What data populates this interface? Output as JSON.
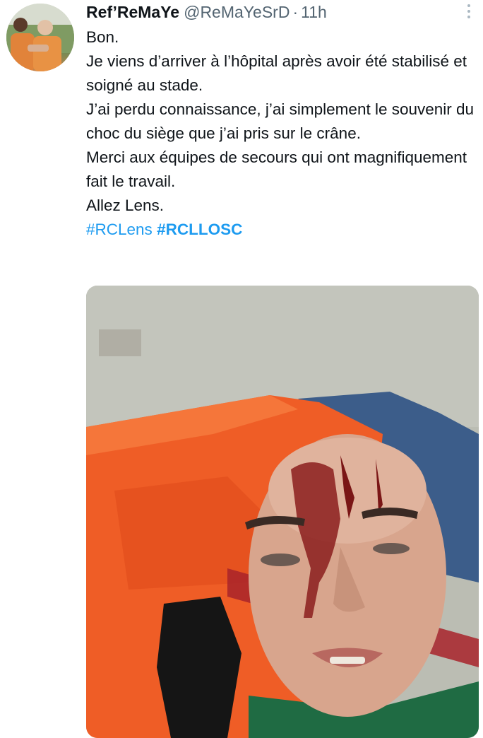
{
  "tweet": {
    "author_name": "Ref’ReMaYe",
    "author_handle": "@ReMaYeSrD",
    "separator": "·",
    "time": "11h",
    "more_icon": "more-vertical-icon",
    "lines": [
      "Bon.",
      "Je viens d’arriver à l’hôpital après avoir été stabilisé et soigné au stade.",
      "J’ai perdu connaissance, j’ai simplement le souvenir du choc du siège que j’ai pris sur le crâne.",
      "Merci aux équipes de secours qui ont magnifiquement fait le travail.",
      "Allez Lens."
    ],
    "hashtags": [
      "#RCLens",
      "#RCLLOSC"
    ],
    "colors": {
      "link": "#1d9bf0",
      "text": "#0f1419",
      "muted": "#536471"
    }
  }
}
